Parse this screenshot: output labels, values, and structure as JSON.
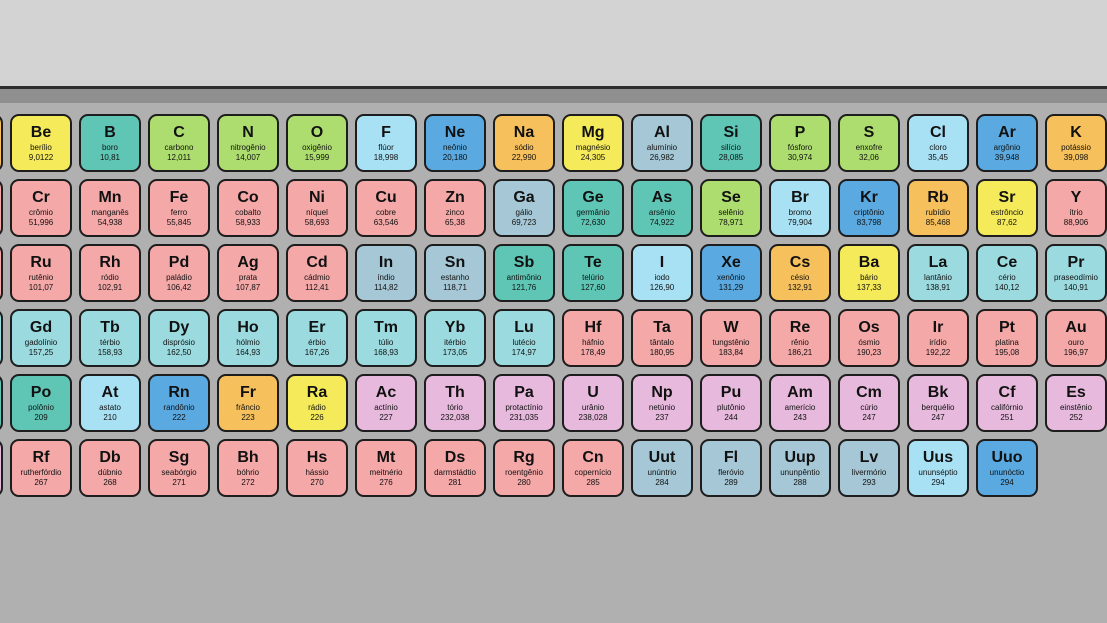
{
  "palette": {
    "yellow": "#f5ea5a",
    "teal": "#5fc6b6",
    "lime": "#addd6e",
    "skyblue": "#a9e1f4",
    "blue": "#5aa9e0",
    "orange": "#f6c05c",
    "grayblue": "#a6c7d6",
    "pink": "#f4a8a8",
    "lightteal": "#9bdbe0",
    "lavender": "#e7b9dd"
  },
  "rows": [
    [
      {
        "symbol": "Be",
        "name": "berílio",
        "mass": "9,0122",
        "color": "yellow"
      },
      {
        "symbol": "B",
        "name": "boro",
        "mass": "10,81",
        "color": "teal"
      },
      {
        "symbol": "C",
        "name": "carbono",
        "mass": "12,011",
        "color": "lime"
      },
      {
        "symbol": "N",
        "name": "nitrogênio",
        "mass": "14,007",
        "color": "lime"
      },
      {
        "symbol": "O",
        "name": "oxigênio",
        "mass": "15,999",
        "color": "lime"
      },
      {
        "symbol": "F",
        "name": "flúor",
        "mass": "18,998",
        "color": "skyblue"
      },
      {
        "symbol": "Ne",
        "name": "neônio",
        "mass": "20,180",
        "color": "blue"
      },
      {
        "symbol": "Na",
        "name": "sódio",
        "mass": "22,990",
        "color": "orange"
      },
      {
        "symbol": "Mg",
        "name": "magnésio",
        "mass": "24,305",
        "color": "yellow"
      },
      {
        "symbol": "Al",
        "name": "alumínio",
        "mass": "26,982",
        "color": "grayblue"
      },
      {
        "symbol": "Si",
        "name": "silício",
        "mass": "28,085",
        "color": "teal"
      },
      {
        "symbol": "P",
        "name": "fósforo",
        "mass": "30,974",
        "color": "lime"
      },
      {
        "symbol": "S",
        "name": "enxofre",
        "mass": "32,06",
        "color": "lime"
      },
      {
        "symbol": "Cl",
        "name": "cloro",
        "mass": "35,45",
        "color": "skyblue"
      },
      {
        "symbol": "Ar",
        "name": "argônio",
        "mass": "39,948",
        "color": "blue"
      },
      {
        "symbol": "K",
        "name": "potássio",
        "mass": "39,098",
        "color": "orange"
      }
    ],
    [
      {
        "symbol": "Cr",
        "name": "crômio",
        "mass": "51,996",
        "color": "pink"
      },
      {
        "symbol": "Mn",
        "name": "manganês",
        "mass": "54,938",
        "color": "pink"
      },
      {
        "symbol": "Fe",
        "name": "ferro",
        "mass": "55,845",
        "color": "pink"
      },
      {
        "symbol": "Co",
        "name": "cobalto",
        "mass": "58,933",
        "color": "pink"
      },
      {
        "symbol": "Ni",
        "name": "níquel",
        "mass": "58,693",
        "color": "pink"
      },
      {
        "symbol": "Cu",
        "name": "cobre",
        "mass": "63,546",
        "color": "pink"
      },
      {
        "symbol": "Zn",
        "name": "zinco",
        "mass": "65,38",
        "color": "pink"
      },
      {
        "symbol": "Ga",
        "name": "gálio",
        "mass": "69,723",
        "color": "grayblue"
      },
      {
        "symbol": "Ge",
        "name": "germânio",
        "mass": "72,630",
        "color": "teal"
      },
      {
        "symbol": "As",
        "name": "arsênio",
        "mass": "74,922",
        "color": "teal"
      },
      {
        "symbol": "Se",
        "name": "selênio",
        "mass": "78,971",
        "color": "lime"
      },
      {
        "symbol": "Br",
        "name": "bromo",
        "mass": "79,904",
        "color": "skyblue"
      },
      {
        "symbol": "Kr",
        "name": "criptônio",
        "mass": "83,798",
        "color": "blue"
      },
      {
        "symbol": "Rb",
        "name": "rubídio",
        "mass": "85,468",
        "color": "orange"
      },
      {
        "symbol": "Sr",
        "name": "estrôncio",
        "mass": "87,62",
        "color": "yellow"
      },
      {
        "symbol": "Y",
        "name": "ítrio",
        "mass": "88,906",
        "color": "pink"
      }
    ],
    [
      {
        "symbol": "Ru",
        "name": "rutênio",
        "mass": "101,07",
        "color": "pink"
      },
      {
        "symbol": "Rh",
        "name": "ródio",
        "mass": "102,91",
        "color": "pink"
      },
      {
        "symbol": "Pd",
        "name": "paládio",
        "mass": "106,42",
        "color": "pink"
      },
      {
        "symbol": "Ag",
        "name": "prata",
        "mass": "107,87",
        "color": "pink"
      },
      {
        "symbol": "Cd",
        "name": "cádmio",
        "mass": "112,41",
        "color": "pink"
      },
      {
        "symbol": "In",
        "name": "índio",
        "mass": "114,82",
        "color": "grayblue"
      },
      {
        "symbol": "Sn",
        "name": "estanho",
        "mass": "118,71",
        "color": "grayblue"
      },
      {
        "symbol": "Sb",
        "name": "antimônio",
        "mass": "121,76",
        "color": "teal"
      },
      {
        "symbol": "Te",
        "name": "telúrio",
        "mass": "127,60",
        "color": "teal"
      },
      {
        "symbol": "I",
        "name": "iodo",
        "mass": "126,90",
        "color": "skyblue"
      },
      {
        "symbol": "Xe",
        "name": "xenônio",
        "mass": "131,29",
        "color": "blue"
      },
      {
        "symbol": "Cs",
        "name": "césio",
        "mass": "132,91",
        "color": "orange"
      },
      {
        "symbol": "Ba",
        "name": "bário",
        "mass": "137,33",
        "color": "yellow"
      },
      {
        "symbol": "La",
        "name": "lantânio",
        "mass": "138,91",
        "color": "lightteal"
      },
      {
        "symbol": "Ce",
        "name": "cério",
        "mass": "140,12",
        "color": "lightteal"
      },
      {
        "symbol": "Pr",
        "name": "praseodímio",
        "mass": "140,91",
        "color": "lightteal"
      }
    ],
    [
      {
        "symbol": "Gd",
        "name": "gadolínio",
        "mass": "157,25",
        "color": "lightteal"
      },
      {
        "symbol": "Tb",
        "name": "térbio",
        "mass": "158,93",
        "color": "lightteal"
      },
      {
        "symbol": "Dy",
        "name": "disprósio",
        "mass": "162,50",
        "color": "lightteal"
      },
      {
        "symbol": "Ho",
        "name": "hólmio",
        "mass": "164,93",
        "color": "lightteal"
      },
      {
        "symbol": "Er",
        "name": "érbio",
        "mass": "167,26",
        "color": "lightteal"
      },
      {
        "symbol": "Tm",
        "name": "túlio",
        "mass": "168,93",
        "color": "lightteal"
      },
      {
        "symbol": "Yb",
        "name": "itérbio",
        "mass": "173,05",
        "color": "lightteal"
      },
      {
        "symbol": "Lu",
        "name": "lutécio",
        "mass": "174,97",
        "color": "lightteal"
      },
      {
        "symbol": "Hf",
        "name": "háfnio",
        "mass": "178,49",
        "color": "pink"
      },
      {
        "symbol": "Ta",
        "name": "tântalo",
        "mass": "180,95",
        "color": "pink"
      },
      {
        "symbol": "W",
        "name": "tungstênio",
        "mass": "183,84",
        "color": "pink"
      },
      {
        "symbol": "Re",
        "name": "rênio",
        "mass": "186,21",
        "color": "pink"
      },
      {
        "symbol": "Os",
        "name": "ósmio",
        "mass": "190,23",
        "color": "pink"
      },
      {
        "symbol": "Ir",
        "name": "irídio",
        "mass": "192,22",
        "color": "pink"
      },
      {
        "symbol": "Pt",
        "name": "platina",
        "mass": "195,08",
        "color": "pink"
      },
      {
        "symbol": "Au",
        "name": "ouro",
        "mass": "196,97",
        "color": "pink"
      }
    ],
    [
      {
        "symbol": "Po",
        "name": "polônio",
        "mass": "209",
        "color": "teal"
      },
      {
        "symbol": "At",
        "name": "astato",
        "mass": "210",
        "color": "skyblue"
      },
      {
        "symbol": "Rn",
        "name": "randônio",
        "mass": "222",
        "color": "blue"
      },
      {
        "symbol": "Fr",
        "name": "frâncio",
        "mass": "223",
        "color": "orange"
      },
      {
        "symbol": "Ra",
        "name": "rádio",
        "mass": "226",
        "color": "yellow"
      },
      {
        "symbol": "Ac",
        "name": "actínio",
        "mass": "227",
        "color": "lavender"
      },
      {
        "symbol": "Th",
        "name": "tório",
        "mass": "232,038",
        "color": "lavender"
      },
      {
        "symbol": "Pa",
        "name": "protactínio",
        "mass": "231,035",
        "color": "lavender"
      },
      {
        "symbol": "U",
        "name": "urânio",
        "mass": "238,028",
        "color": "lavender"
      },
      {
        "symbol": "Np",
        "name": "netúnio",
        "mass": "237",
        "color": "lavender"
      },
      {
        "symbol": "Pu",
        "name": "plutônio",
        "mass": "244",
        "color": "lavender"
      },
      {
        "symbol": "Am",
        "name": "amerício",
        "mass": "243",
        "color": "lavender"
      },
      {
        "symbol": "Cm",
        "name": "cúrio",
        "mass": "247",
        "color": "lavender"
      },
      {
        "symbol": "Bk",
        "name": "berquélio",
        "mass": "247",
        "color": "lavender"
      },
      {
        "symbol": "Cf",
        "name": "califórnio",
        "mass": "251",
        "color": "lavender"
      },
      {
        "symbol": "Es",
        "name": "einstênio",
        "mass": "252",
        "color": "lavender"
      }
    ],
    [
      {
        "symbol": "Rf",
        "name": "rutherfórdio",
        "mass": "267",
        "color": "pink"
      },
      {
        "symbol": "Db",
        "name": "dúbnio",
        "mass": "268",
        "color": "pink"
      },
      {
        "symbol": "Sg",
        "name": "seabórgio",
        "mass": "271",
        "color": "pink"
      },
      {
        "symbol": "Bh",
        "name": "bóhrio",
        "mass": "272",
        "color": "pink"
      },
      {
        "symbol": "Hs",
        "name": "hássio",
        "mass": "270",
        "color": "pink"
      },
      {
        "symbol": "Mt",
        "name": "meitnério",
        "mass": "276",
        "color": "pink"
      },
      {
        "symbol": "Ds",
        "name": "darmstádtio",
        "mass": "281",
        "color": "pink"
      },
      {
        "symbol": "Rg",
        "name": "roentgênio",
        "mass": "280",
        "color": "pink"
      },
      {
        "symbol": "Cn",
        "name": "copernício",
        "mass": "285",
        "color": "pink"
      },
      {
        "symbol": "Uut",
        "name": "unúntrio",
        "mass": "284",
        "color": "grayblue"
      },
      {
        "symbol": "Fl",
        "name": "fleróvio",
        "mass": "289",
        "color": "grayblue"
      },
      {
        "symbol": "Uup",
        "name": "ununpêntio",
        "mass": "288",
        "color": "grayblue"
      },
      {
        "symbol": "Lv",
        "name": "livermório",
        "mass": "293",
        "color": "grayblue"
      },
      {
        "symbol": "Uus",
        "name": "ununséptio",
        "mass": "294",
        "color": "skyblue"
      },
      {
        "symbol": "Uuo",
        "name": "ununóctio",
        "mass": "294",
        "color": "blue"
      }
    ]
  ],
  "left_edge_colors": [
    "orange",
    "pink",
    "pink",
    "lightteal",
    "teal",
    "lavender"
  ]
}
